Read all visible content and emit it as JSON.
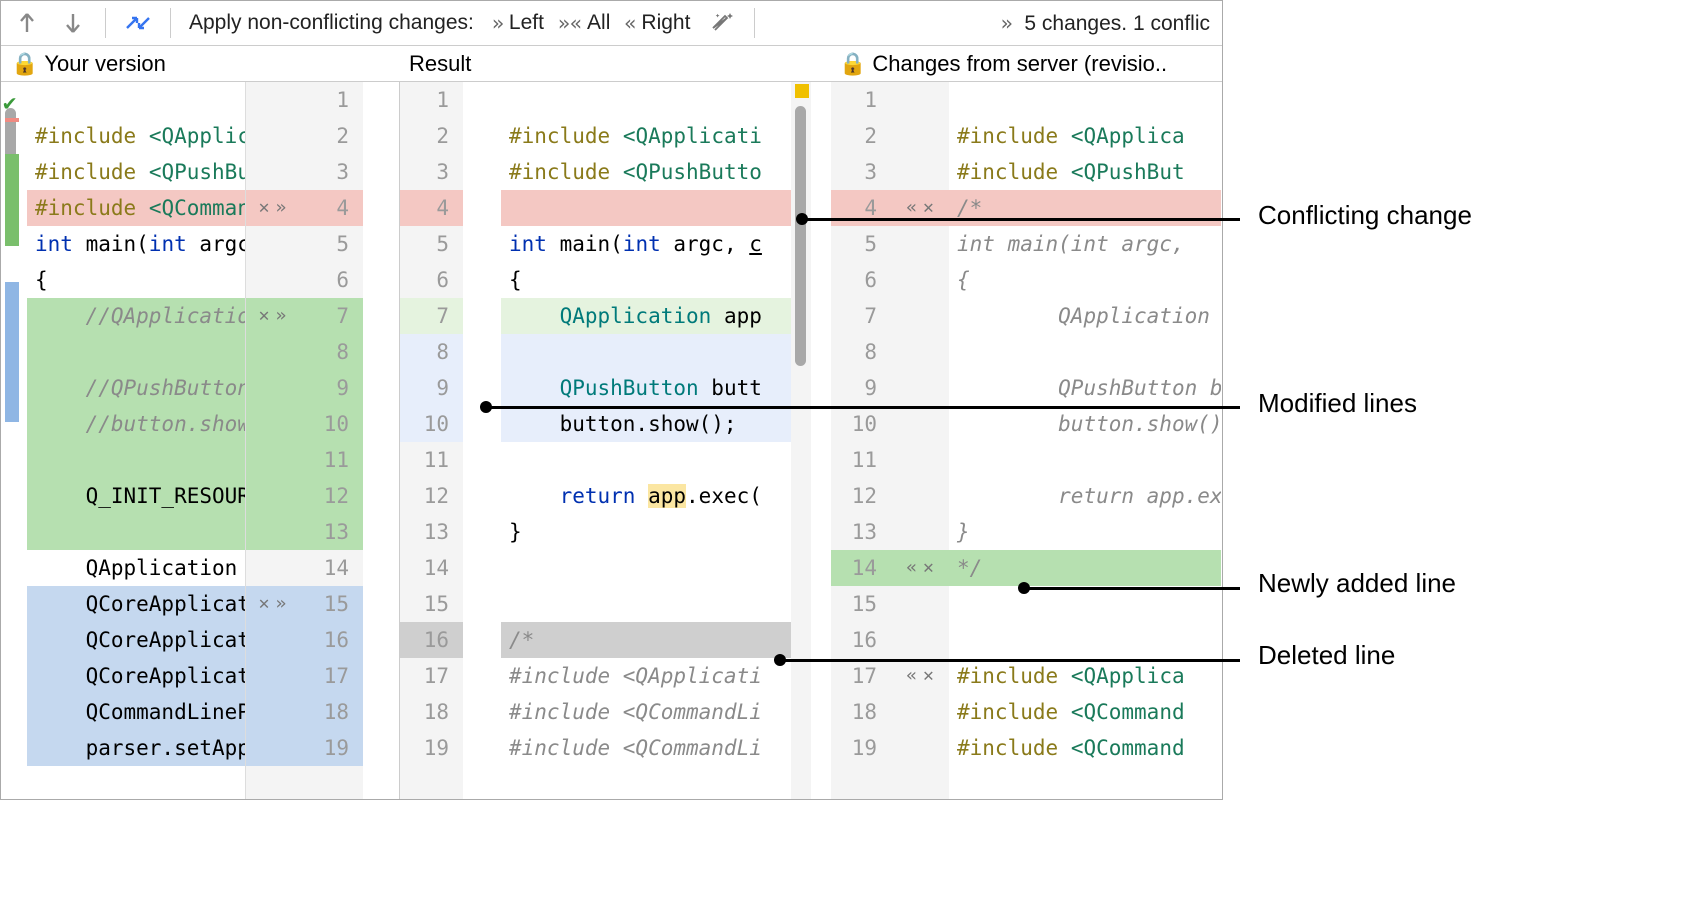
{
  "toolbar": {
    "apply_label": "Apply non-conflicting changes:",
    "left": "Left",
    "all": "All",
    "right": "Right",
    "status": "5 changes. 1 conflic"
  },
  "header": {
    "left": "Your version",
    "mid": "Result",
    "right": "Changes from server (revisio.."
  },
  "left_lines": [
    {
      "n": "1",
      "html": ""
    },
    {
      "n": "2",
      "html": "<span class='kw'>#include</span> <span class='inc'>&lt;QApplic</span>"
    },
    {
      "n": "3",
      "html": "<span class='kw'>#include</span> <span class='inc'>&lt;QPushBu</span>"
    },
    {
      "n": "4",
      "html": "<span class='kw'>#include</span> <span class='inc'>&lt;QComman</span>",
      "cls": "bg-conflict",
      "act": "xr"
    },
    {
      "n": "5",
      "html": "<span class='kw2'>int</span> main(<span class='kw2'>int</span> argc"
    },
    {
      "n": "6",
      "html": "{"
    },
    {
      "n": "7",
      "html": "&nbsp;&nbsp;&nbsp;&nbsp;<span class='cm'>//QApplicatio</span>",
      "cls": "bg-insert",
      "act": "xr"
    },
    {
      "n": "8",
      "html": "",
      "cls": "bg-insert"
    },
    {
      "n": "9",
      "html": "&nbsp;&nbsp;&nbsp;&nbsp;<span class='cm'>//QPushButton</span>",
      "cls": "bg-insert"
    },
    {
      "n": "10",
      "html": "&nbsp;&nbsp;&nbsp;&nbsp;<span class='cm'>//button.show</span>",
      "cls": "bg-insert"
    },
    {
      "n": "11",
      "html": "",
      "cls": "bg-insert"
    },
    {
      "n": "12",
      "html": "&nbsp;&nbsp;&nbsp;&nbsp;Q_INIT_RESOUR",
      "cls": "bg-insert"
    },
    {
      "n": "13",
      "html": "",
      "cls": "bg-insert"
    },
    {
      "n": "14",
      "html": "&nbsp;&nbsp;&nbsp;&nbsp;QApplication"
    },
    {
      "n": "15",
      "html": "&nbsp;&nbsp;&nbsp;&nbsp;QCoreApplicat",
      "cls": "bg-mod",
      "act": "xr"
    },
    {
      "n": "16",
      "html": "&nbsp;&nbsp;&nbsp;&nbsp;QCoreApplicat",
      "cls": "bg-mod"
    },
    {
      "n": "17",
      "html": "&nbsp;&nbsp;&nbsp;&nbsp;QCoreApplicat",
      "cls": "bg-mod"
    },
    {
      "n": "18",
      "html": "&nbsp;&nbsp;&nbsp;&nbsp;QCommandLineP",
      "cls": "bg-mod"
    },
    {
      "n": "19",
      "html": "&nbsp;&nbsp;&nbsp;&nbsp;parser.setApp",
      "cls": "bg-mod"
    }
  ],
  "mid_lines": [
    {
      "n": "1",
      "html": ""
    },
    {
      "n": "2",
      "html": "<span class='kw'>#include</span> <span class='inc'>&lt;QApplicati</span>"
    },
    {
      "n": "3",
      "html": "<span class='kw'>#include</span> <span class='inc'>&lt;QPushButto</span>"
    },
    {
      "n": "4",
      "html": "",
      "cls": "bg-conflict"
    },
    {
      "n": "5",
      "html": "<span class='kw2'>int</span> main(<span class='kw2'>int</span> argc, <span style='text-decoration:underline'>c</span>"
    },
    {
      "n": "6",
      "html": "{"
    },
    {
      "n": "7",
      "html": "&nbsp;&nbsp;&nbsp;&nbsp;<span class='ty'>QApplication</span> app",
      "cls": "bg-insert-light"
    },
    {
      "n": "8",
      "html": "",
      "cls": "bg-mod-light"
    },
    {
      "n": "9",
      "html": "&nbsp;&nbsp;&nbsp;&nbsp;<span class='ty'>QPushButton</span> butt",
      "cls": "bg-mod-light"
    },
    {
      "n": "10",
      "html": "&nbsp;&nbsp;&nbsp;&nbsp;button.show();",
      "cls": "bg-mod-light"
    },
    {
      "n": "11",
      "html": ""
    },
    {
      "n": "12",
      "html": "&nbsp;&nbsp;&nbsp;&nbsp;<span class='kw2'>return</span> <span class='hl'>app</span>.exec("
    },
    {
      "n": "13",
      "html": "}"
    },
    {
      "n": "14",
      "html": ""
    },
    {
      "n": "15",
      "html": ""
    },
    {
      "n": "16",
      "html": "<span class='cm'>/*</span>",
      "cls": "bg-del"
    },
    {
      "n": "17",
      "html": "<span class='cm'>#include &lt;QApplicati</span>"
    },
    {
      "n": "18",
      "html": "<span class='cm'>#include &lt;QCommandLi</span>"
    },
    {
      "n": "19",
      "html": "<span class='cm'>#include &lt;QCommandLi</span>"
    }
  ],
  "right_lines": [
    {
      "n": "1",
      "html": ""
    },
    {
      "n": "2",
      "html": "<span class='kw'>#include</span> <span class='inc'>&lt;QApplica</span>"
    },
    {
      "n": "3",
      "html": "<span class='kw'>#include</span> <span class='inc'>&lt;QPushBut</span>"
    },
    {
      "n": "4",
      "html": "<span class='it'>/*</span>",
      "cls": "bg-conflict",
      "act": "lx"
    },
    {
      "n": "5",
      "html": "<span class='it'>int main(int argc,</span>"
    },
    {
      "n": "6",
      "html": "<span class='it'>{</span>"
    },
    {
      "n": "7",
      "html": "&nbsp;&nbsp;&nbsp;&nbsp;&nbsp;&nbsp;&nbsp;&nbsp;<span class='it'>QApplication a</span>"
    },
    {
      "n": "8",
      "html": ""
    },
    {
      "n": "9",
      "html": "&nbsp;&nbsp;&nbsp;&nbsp;&nbsp;&nbsp;&nbsp;&nbsp;<span class='it'>QPushButton bu</span>"
    },
    {
      "n": "10",
      "html": "&nbsp;&nbsp;&nbsp;&nbsp;&nbsp;&nbsp;&nbsp;&nbsp;<span class='it'>button.show();</span>"
    },
    {
      "n": "11",
      "html": ""
    },
    {
      "n": "12",
      "html": "&nbsp;&nbsp;&nbsp;&nbsp;&nbsp;&nbsp;&nbsp;&nbsp;<span class='it'>return app.exe</span>"
    },
    {
      "n": "13",
      "html": "<span class='it'>}</span>"
    },
    {
      "n": "14",
      "html": "<span class='it'>*/</span>",
      "cls": "bg-insert",
      "act": "lx"
    },
    {
      "n": "15",
      "html": ""
    },
    {
      "n": "16",
      "html": ""
    },
    {
      "n": "17",
      "html": "<span class='kw'>#include</span> <span class='inc'>&lt;QApplica</span>",
      "act": "lx"
    },
    {
      "n": "18",
      "html": "<span class='kw'>#include</span> <span class='inc'>&lt;QCommand</span>"
    },
    {
      "n": "19",
      "html": "<span class='kw'>#include</span> <span class='inc'>&lt;QCommand</span>"
    }
  ],
  "annotations": {
    "conflict": "Conflicting change",
    "modified": "Modified lines",
    "added": "Newly added line",
    "deleted": "Deleted line"
  }
}
